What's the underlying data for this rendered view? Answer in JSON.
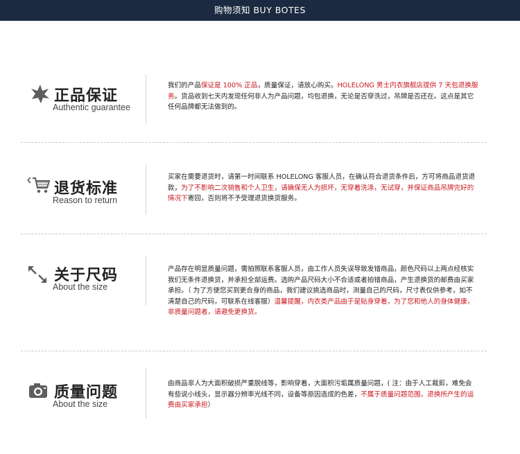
{
  "header": {
    "title": "购物须知 BUY BOTES"
  },
  "sections": [
    {
      "icon": "star-icon",
      "title": "正品保证",
      "subtitle": "Authentic guarantee",
      "text": {
        "a": "我们的产品",
        "b": "保证是 100% 正品",
        "c": "，质量保证，请放心购买。",
        "d": "HOLELONG 男士内衣旗舰店提供 7 天包退换服务",
        "e": "。货品收到七天内发现任何非人为产品问题，均包退换，无论是否穿洗过，吊牌是否还在。这点是其它任何品牌都无法做到的。"
      }
    },
    {
      "icon": "shopping-cart-icon",
      "title": "退货标准",
      "subtitle": "Reason to return",
      "text": {
        "a": "买家在需要退货时，请第一时间联系 HOLELONG 客服人员，在确认符合退货条件后，方可将商品退货退款，",
        "b": "为了不影响二次销售和个人卫生，请确保无人为损坏，无穿着洗涤，无试穿，并保证商品吊牌完好的情况下",
        "c": "寄回，否则将不予受理退货换货服务。"
      }
    },
    {
      "icon": "resize-arrows-icon",
      "title": "关于尺码",
      "subtitle": "About the size",
      "text": {
        "a": "产品存在明显质量问题，需拍照联系客服人员，由工作人员失误导致发错商品，颜色尺码以上两点经核实我们无条件退换货，并承担全部运费。选购产品尺码大小不合适或者拍错商品，产生退换货的邮费由买家承担。（ 为了方便您买到更合身的商品，我们建议挑选商品时，测量自己的尺码，尺寸表仅供参考，如不清楚自己的尺码，可联系在线客服）",
        "b": "温馨提醒，内衣类产品由于是贴身穿着，为了您和他人的身体健康，非质量问题者，请避免更换货。"
      }
    },
    {
      "icon": "camera-icon",
      "title": "质量问题",
      "subtitle": "About the size",
      "text": {
        "a": "由商品非人为大面积破损严重脱线等，影响穿着，大面积污垢属质量问题，( 注：由于人工裁剪，难免会有些说小线头，显示器分辨率光线不同，设备等原因造成的色差，",
        "b": "不属于质量问题范围，退换所产生的运费由买家承担",
        "c": "）"
      }
    }
  ],
  "colors": {
    "header_bg": "#1b2a40",
    "accent_red": "#c8161d"
  }
}
